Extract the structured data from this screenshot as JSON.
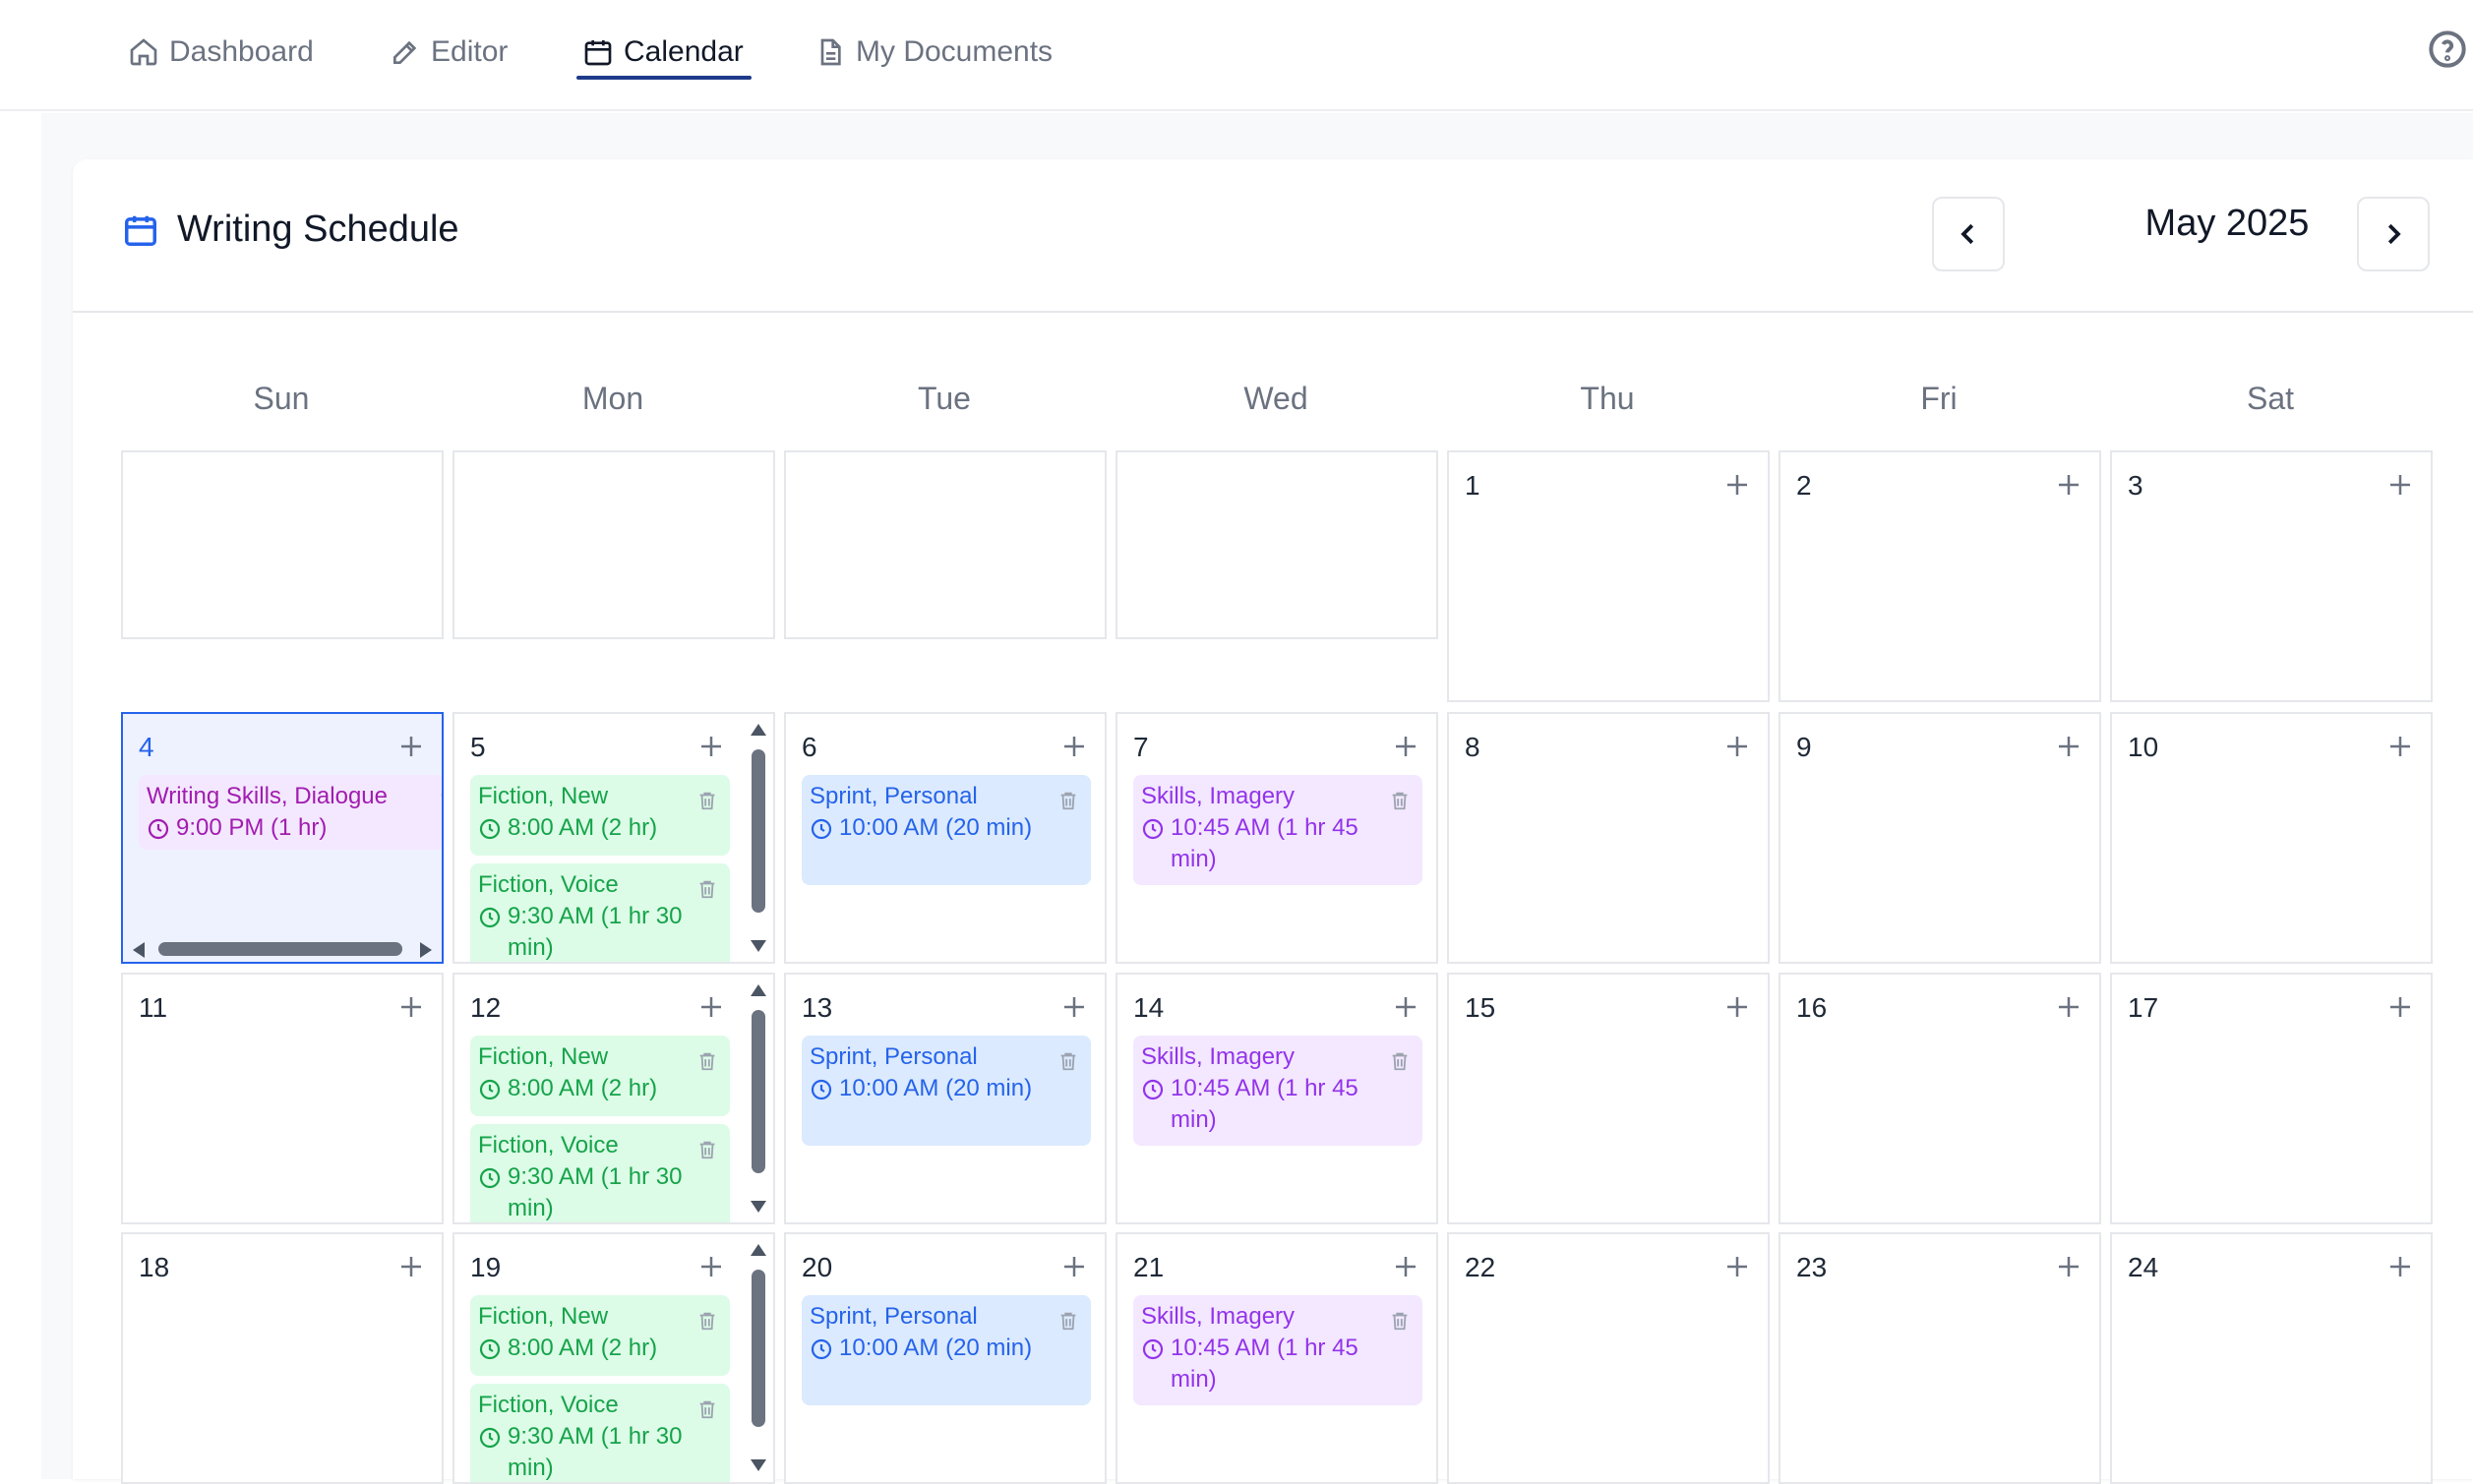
{
  "nav": {
    "items": [
      {
        "label": "Dashboard",
        "icon": "home-icon"
      },
      {
        "label": "Editor",
        "icon": "pencil-icon"
      },
      {
        "label": "Calendar",
        "icon": "calendar-icon",
        "active": true
      },
      {
        "label": "My Documents",
        "icon": "document-icon"
      }
    ],
    "help_icon": "help-circle-icon"
  },
  "header": {
    "title": "Writing Schedule",
    "month": "May 2025",
    "prev_icon": "chevron-left-icon",
    "next_icon": "chevron-right-icon"
  },
  "weekdays": [
    "Sun",
    "Mon",
    "Tue",
    "Wed",
    "Thu",
    "Fri",
    "Sat"
  ],
  "days": {
    "d1": "1",
    "d2": "2",
    "d3": "3",
    "d4": "4",
    "d5": "5",
    "d6": "6",
    "d7": "7",
    "d8": "8",
    "d9": "9",
    "d10": "10",
    "d11": "11",
    "d12": "12",
    "d13": "13",
    "d14": "14",
    "d15": "15",
    "d16": "16",
    "d17": "17",
    "d18": "18",
    "d19": "19",
    "d20": "20",
    "d21": "21",
    "d22": "22",
    "d23": "23",
    "d24": "24"
  },
  "events": {
    "e4a": {
      "title": "Writing Skills, Dialogue",
      "time": "9:00 PM (1 hr)"
    },
    "e5a": {
      "title": "Fiction, New",
      "time": "8:00 AM (2 hr)"
    },
    "e5b": {
      "title": "Fiction, Voice",
      "time": "9:30 AM (1 hr 30 min)"
    },
    "e6a": {
      "title": "Sprint, Personal",
      "time": "10:00 AM (20 min)"
    },
    "e7a": {
      "title": "Skills, Imagery",
      "time": "10:45 AM (1 hr 45 min)"
    },
    "e12a": {
      "title": "Fiction, New",
      "time": "8:00 AM (2 hr)"
    },
    "e12b": {
      "title": "Fiction, Voice",
      "time": "9:30 AM (1 hr 30 min)"
    },
    "e13a": {
      "title": "Sprint, Personal",
      "time": "10:00 AM (20 min)"
    },
    "e14a": {
      "title": "Skills, Imagery",
      "time": "10:45 AM (1 hr 45 min)"
    },
    "e19a": {
      "title": "Fiction, New",
      "time": "8:00 AM (2 hr)"
    },
    "e19b": {
      "title": "Fiction, Voice",
      "time": "9:30 AM (1 hr 30 min)"
    },
    "e20a": {
      "title": "Sprint, Personal",
      "time": "10:00 AM (20 min)"
    },
    "e21a": {
      "title": "Skills, Imagery",
      "time": "10:45 AM (1 hr 45 min)"
    }
  },
  "colors": {
    "accent": "#2563eb",
    "fiction": "#16a34a",
    "sprint": "#2563eb",
    "skills": "#9333ea",
    "today_bg": "#eef2ff"
  }
}
